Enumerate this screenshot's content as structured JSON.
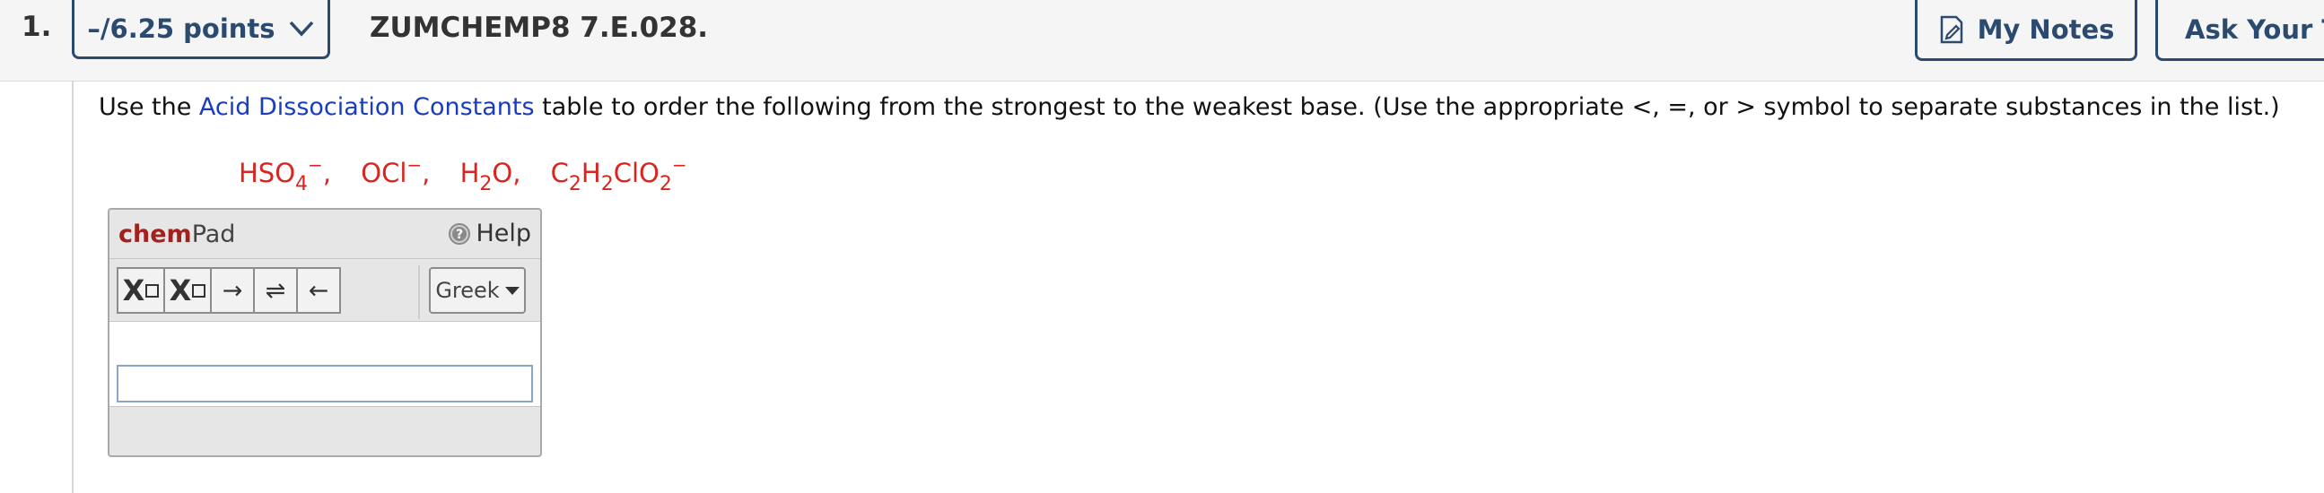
{
  "header": {
    "question_number": "1.",
    "points_label": "–/6.25 points",
    "question_code": "ZUMCHEMP8 7.E.028.",
    "my_notes_label": "My Notes",
    "ask_teacher_label": "Ask Your Te"
  },
  "question": {
    "prompt_before": "Use the ",
    "link_text": "Acid Dissociation Constants",
    "prompt_after": " table to order the following from the strongest to the weakest base. (Use the appropriate <, =, or > symbol to separate substances in the list.)",
    "species": [
      {
        "base": "HSO",
        "sub": "4",
        "sup": "−",
        "sep": ","
      },
      {
        "base": "OCl",
        "sub": "",
        "sup": "−",
        "sep": ","
      },
      {
        "base": "H",
        "sub": "2",
        "tail": "O",
        "sup": "",
        "sep": ","
      },
      {
        "base": "C",
        "sub": "2",
        "mid": "H",
        "sub2": "2",
        "tail": "ClO",
        "sub3": "2",
        "sup": "−",
        "sep": ""
      }
    ]
  },
  "chempad": {
    "title_chem": "chem",
    "title_pad": "Pad",
    "help_label": "Help",
    "toolbar": {
      "subscript_label": "X",
      "superscript_label": "X",
      "arrow_right": "→",
      "arrow_equilibrium": "⇌",
      "arrow_left": "←",
      "greek_label": "Greek"
    },
    "input_value": ""
  },
  "colors": {
    "accent": "#2b4a6f",
    "link": "#1a3dbf",
    "formula": "#d8261f",
    "chem_brand": "#a3201c"
  }
}
